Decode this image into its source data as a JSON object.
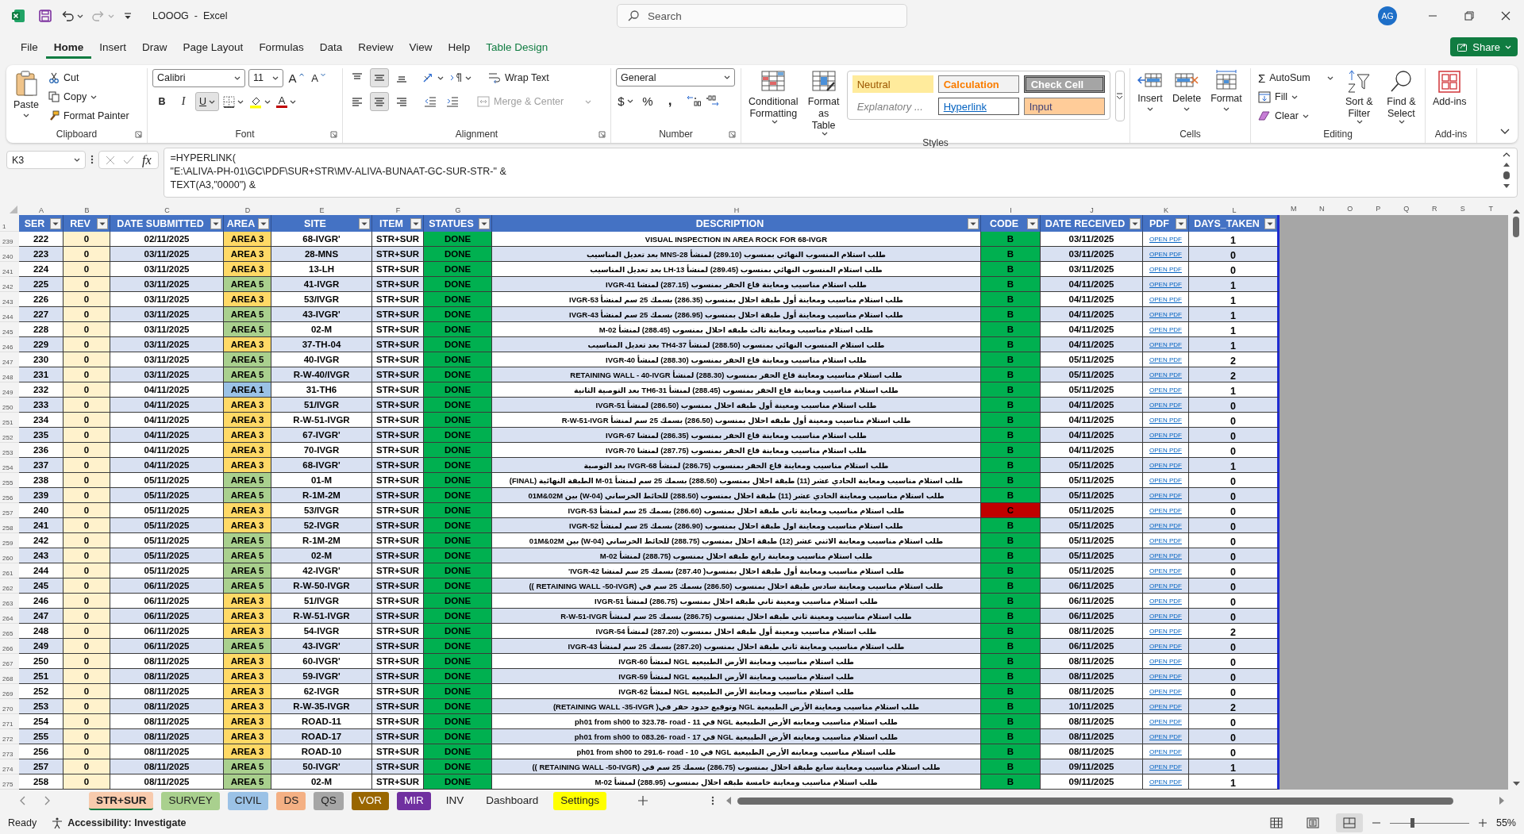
{
  "title_bar": {
    "title": "LOOOG  -  Excel",
    "search_placeholder": "Search",
    "user_initials": "AG"
  },
  "menu_tabs": [
    {
      "label": "File",
      "selected": false
    },
    {
      "label": "Home",
      "selected": true
    },
    {
      "label": "Insert",
      "selected": false
    },
    {
      "label": "Draw",
      "selected": false
    },
    {
      "label": "Page Layout",
      "selected": false
    },
    {
      "label": "Formulas",
      "selected": false
    },
    {
      "label": "Data",
      "selected": false
    },
    {
      "label": "Review",
      "selected": false
    },
    {
      "label": "View",
      "selected": false
    },
    {
      "label": "Help",
      "selected": false
    },
    {
      "label": "Table Design",
      "selected": false,
      "kind": "contextual"
    }
  ],
  "share_button": "Share",
  "ribbon": {
    "clipboard": {
      "label": "Clipboard",
      "paste": "Paste",
      "cut": "Cut",
      "copy": "Copy",
      "format_painter": "Format Painter"
    },
    "font": {
      "label": "Font",
      "font_name": "Calibri",
      "font_size": "11",
      "grow_font": "A",
      "shrink_font": "A",
      "bold": "B",
      "italic": "I",
      "underline": {
        "text": "U",
        "on": true
      },
      "font_color": "A"
    },
    "alignment": {
      "label": "Alignment",
      "vertical_buttons": [
        {
          "kind": "top",
          "selected": false
        },
        {
          "kind": "middle",
          "selected": true
        },
        {
          "kind": "bottom",
          "selected": false
        }
      ],
      "horizontal_buttons": [
        {
          "kind": "left",
          "selected": false
        },
        {
          "kind": "center",
          "selected": true
        },
        {
          "kind": "right",
          "selected": false
        }
      ],
      "wrap_text": "Wrap Text",
      "merge_center": {
        "text": "Merge & Center",
        "disabled": true
      }
    },
    "number": {
      "label": "Number",
      "format": "General",
      "currency": "$",
      "percent": "%",
      "comma": ","
    },
    "styles": {
      "label": "Styles",
      "conditional_formatting": "Conditional Formatting",
      "format_as_table": "Format as Table",
      "cell_styles": [
        {
          "text": "Neutral",
          "kind": "neutral"
        },
        {
          "text": "Calculation",
          "kind": "calculation"
        },
        {
          "text": "Check Cell",
          "kind": "check"
        },
        {
          "text": "Explanatory ...",
          "kind": "explanatory"
        },
        {
          "text": "Hyperlink",
          "kind": "hyperlink"
        },
        {
          "text": "Input",
          "kind": "input"
        }
      ]
    },
    "cells": {
      "label": "Cells",
      "buttons": [
        {
          "text": "Insert",
          "kind": "insert"
        },
        {
          "text": "Delete",
          "kind": "delete"
        },
        {
          "text": "Format",
          "kind": "format"
        }
      ]
    },
    "editing": {
      "label": "Editing",
      "autosum_icon": "Σ",
      "autosum": "AutoSum",
      "fill": "Fill",
      "clear": "Clear",
      "sort_filter": "Sort & Filter",
      "find_select": "Find & Select"
    },
    "addins": {
      "label": "Add-ins",
      "button": "Add-ins"
    }
  },
  "formula_bar": {
    "name_box": "K3",
    "fx": "fx",
    "formula": "=HYPERLINK(\n\"E:\\ALIVA-PH-01\\GC\\PDF\\SUR+STR\\MV-ALIVA-BUNAAT-GC-SUR-STR-\" &\nTEXT(A3,\"0000\") &"
  },
  "sheet": {
    "column_letters": [
      "A",
      "B",
      "C",
      "D",
      "E",
      "F",
      "G",
      "H",
      "I",
      "J",
      "K",
      "L",
      "M",
      "N",
      "O",
      "P",
      "Q",
      "R",
      "S",
      "T"
    ],
    "header_row_number": "1",
    "columns": [
      "SER",
      "REV",
      "DATE SUBMITTED",
      "AREA",
      "SITE",
      "ITEM",
      "STATUES",
      "DESCRIPTION",
      "CODE",
      "DATE RECEIVED",
      "PDF",
      "DAYS_TAKEN"
    ],
    "rows": [
      {
        "row_number": "239",
        "ser": "222",
        "rev": "0",
        "date_submitted": "02/11/2025",
        "area": {
          "text": "AREA 3",
          "color": "#ffd966"
        },
        "site": "68-IVGR'",
        "item": "STR+SUR",
        "status": "DONE",
        "description": "VISUAL INSPECTION IN AREA ROCK FOR 68-IVGR",
        "code": {
          "text": "B",
          "color": "#00b050"
        },
        "date_received": "03/11/2025",
        "pdf": "OPEN PDF",
        "days_taken": "1"
      },
      {
        "row_number": "240",
        "ser": "223",
        "rev": "0",
        "date_submitted": "03/11/2025",
        "area": {
          "text": "AREA 3",
          "color": "#ffd966"
        },
        "site": "28-MNS",
        "item": "STR+SUR",
        "status": "DONE",
        "description": "طلب استلام المنسوب النهائي بمنسوب (289.10) لمنشأ MNS-28 بعد تعديل المناسيب",
        "code": {
          "text": "B",
          "color": "#00b050"
        },
        "date_received": "03/11/2025",
        "pdf": "OPEN PDF",
        "days_taken": "0"
      },
      {
        "row_number": "241",
        "ser": "224",
        "rev": "0",
        "date_submitted": "03/11/2025",
        "area": {
          "text": "AREA 3",
          "color": "#ffd966"
        },
        "site": "13-LH",
        "item": "STR+SUR",
        "status": "DONE",
        "description": "طلب استلام المنسوب النهائي بمنسوب (289.45) لمنشأ LH-13 بعد تعديل المناسيب",
        "code": {
          "text": "B",
          "color": "#00b050"
        },
        "date_received": "03/11/2025",
        "pdf": "OPEN PDF",
        "days_taken": "0"
      },
      {
        "row_number": "242",
        "ser": "225",
        "rev": "0",
        "date_submitted": "03/11/2025",
        "area": {
          "text": "AREA 5",
          "color": "#a9d08e"
        },
        "site": "41-IVGR",
        "item": "STR+SUR",
        "status": "DONE",
        "description": "طلب استلام مناسيب ومعاينة قاع الحفر بمنسوب (287.15) لمنشا IVGR-41",
        "code": {
          "text": "B",
          "color": "#00b050"
        },
        "date_received": "04/11/2025",
        "pdf": "OPEN PDF",
        "days_taken": "1"
      },
      {
        "row_number": "243",
        "ser": "226",
        "rev": "0",
        "date_submitted": "03/11/2025",
        "area": {
          "text": "AREA 3",
          "color": "#ffd966"
        },
        "site": "53/IVGR",
        "item": "STR+SUR",
        "status": "DONE",
        "description": "طلب استلام مناسيب ومعاينة أول طبقة احلال بمنسوب (286.35) بسمك 25 سم لمنشأ IVGR-53",
        "code": {
          "text": "B",
          "color": "#00b050"
        },
        "date_received": "04/11/2025",
        "pdf": "OPEN PDF",
        "days_taken": "1"
      },
      {
        "row_number": "244",
        "ser": "227",
        "rev": "0",
        "date_submitted": "03/11/2025",
        "area": {
          "text": "AREA 5",
          "color": "#a9d08e"
        },
        "site": "43-IVGR'",
        "item": "STR+SUR",
        "status": "DONE",
        "description": "طلب استلام مناسيب ومعاينة أول طبقة احلال بمنسوب (286.95) بسمك 25 سم لمنشأ IVGR-43",
        "code": {
          "text": "B",
          "color": "#00b050"
        },
        "date_received": "04/11/2025",
        "pdf": "OPEN PDF",
        "days_taken": "1"
      },
      {
        "row_number": "245",
        "ser": "228",
        "rev": "0",
        "date_submitted": "03/11/2025",
        "area": {
          "text": "AREA 5",
          "color": "#a9d08e"
        },
        "site": "02-M",
        "item": "STR+SUR",
        "status": "DONE",
        "description": "طلب استلام مناسيب ومعاينة ثالث طبقه احلال بمنسوب (288.45) لمنشأ M-02",
        "code": {
          "text": "B",
          "color": "#00b050"
        },
        "date_received": "04/11/2025",
        "pdf": "OPEN PDF",
        "days_taken": "1"
      },
      {
        "row_number": "246",
        "ser": "229",
        "rev": "0",
        "date_submitted": "03/11/2025",
        "area": {
          "text": "AREA 3",
          "color": "#ffd966"
        },
        "site": "37-TH-04",
        "item": "STR+SUR",
        "status": "DONE",
        "description": "طلب استلام المنسوب النهائي بمنسوب (288.50) لمنشأ TH4-37 بعد تعديل المناسيب",
        "code": {
          "text": "B",
          "color": "#00b050"
        },
        "date_received": "04/11/2025",
        "pdf": "OPEN PDF",
        "days_taken": "1"
      },
      {
        "row_number": "247",
        "ser": "230",
        "rev": "0",
        "date_submitted": "03/11/2025",
        "area": {
          "text": "AREA 5",
          "color": "#a9d08e"
        },
        "site": "40-IVGR",
        "item": "STR+SUR",
        "status": "DONE",
        "description": "طلب استلام مناسيب ومعاينة قاع الحفر بمنسوب (288.30) لمنشأ IVGR-40",
        "code": {
          "text": "B",
          "color": "#00b050"
        },
        "date_received": "05/11/2025",
        "pdf": "OPEN PDF",
        "days_taken": "2"
      },
      {
        "row_number": "248",
        "ser": "231",
        "rev": "0",
        "date_submitted": "03/11/2025",
        "area": {
          "text": "AREA 5",
          "color": "#a9d08e"
        },
        "site": "R-W-40/IVGR",
        "item": "STR+SUR",
        "status": "DONE",
        "description": "طلب استلام مناسيب ومعاينة قاع الحفر بمنسوب (288.30) لمنشأ RETAINING WALL - 40-IVGR",
        "code": {
          "text": "B",
          "color": "#00b050"
        },
        "date_received": "05/11/2025",
        "pdf": "OPEN PDF",
        "days_taken": "2"
      },
      {
        "row_number": "249",
        "ser": "232",
        "rev": "0",
        "date_submitted": "04/11/2025",
        "area": {
          "text": "AREA 1",
          "color": "#9bc2e6"
        },
        "site": "31-TH6",
        "item": "STR+SUR",
        "status": "DONE",
        "description": "طلب استلام مناسيب ومعاينة قاع الحفر بمنسوب (288.45) لمنشأ TH6-31 بعد التوصية الثانية",
        "code": {
          "text": "B",
          "color": "#00b050"
        },
        "date_received": "05/11/2025",
        "pdf": "OPEN PDF",
        "days_taken": "1"
      },
      {
        "row_number": "250",
        "ser": "233",
        "rev": "0",
        "date_submitted": "04/11/2025",
        "area": {
          "text": "AREA 3",
          "color": "#ffd966"
        },
        "site": "51/IVGR",
        "item": "STR+SUR",
        "status": "DONE",
        "description": "طلب استلام مناسيب ومعينة أول طبقه احلال بمنسوب (286.50) لمنشأ IVGR-51",
        "code": {
          "text": "B",
          "color": "#00b050"
        },
        "date_received": "04/11/2025",
        "pdf": "OPEN PDF",
        "days_taken": "0"
      },
      {
        "row_number": "251",
        "ser": "234",
        "rev": "0",
        "date_submitted": "04/11/2025",
        "area": {
          "text": "AREA 3",
          "color": "#ffd966"
        },
        "site": "R-W-51-IVGR",
        "item": "STR+SUR",
        "status": "DONE",
        "description": "طلب استلام مناسيب ومعينة أول طبقه احلال بمنسوب (286.50) بسمك 25 سم لمنشأ R-W-51-IVGR",
        "code": {
          "text": "B",
          "color": "#00b050"
        },
        "date_received": "04/11/2025",
        "pdf": "OPEN PDF",
        "days_taken": "0"
      },
      {
        "row_number": "252",
        "ser": "235",
        "rev": "0",
        "date_submitted": "04/11/2025",
        "area": {
          "text": "AREA 3",
          "color": "#ffd966"
        },
        "site": "67-IVGR'",
        "item": "STR+SUR",
        "status": "DONE",
        "description": "طلب استلام مناسيب ومعاينة قاع الحفر بمنسوب (286.35) لمنشا IVGR-67",
        "code": {
          "text": "B",
          "color": "#00b050"
        },
        "date_received": "04/11/2025",
        "pdf": "OPEN PDF",
        "days_taken": "0"
      },
      {
        "row_number": "253",
        "ser": "236",
        "rev": "0",
        "date_submitted": "04/11/2025",
        "area": {
          "text": "AREA 3",
          "color": "#ffd966"
        },
        "site": "70-IVGR",
        "item": "STR+SUR",
        "status": "DONE",
        "description": "طلب استلام مناسيب ومعاينة قاع الحفر بمنسوب (287.75) لمنشا IVGR-70",
        "code": {
          "text": "B",
          "color": "#00b050"
        },
        "date_received": "04/11/2025",
        "pdf": "OPEN PDF",
        "days_taken": "0"
      },
      {
        "row_number": "254",
        "ser": "237",
        "rev": "0",
        "date_submitted": "04/11/2025",
        "area": {
          "text": "AREA 3",
          "color": "#ffd966"
        },
        "site": "68-IVGR'",
        "item": "STR+SUR",
        "status": "DONE",
        "description": "طلب استلام مناسيب ومعاينة قاع الحفر بمنسوب (286.75) لمنشأ IVGR-68 بعد التوصية",
        "code": {
          "text": "B",
          "color": "#00b050"
        },
        "date_received": "05/11/2025",
        "pdf": "OPEN PDF",
        "days_taken": "1"
      },
      {
        "row_number": "255",
        "ser": "238",
        "rev": "0",
        "date_submitted": "05/11/2025",
        "area": {
          "text": "AREA 5",
          "color": "#a9d08e"
        },
        "site": "01-M",
        "item": "STR+SUR",
        "status": "DONE",
        "description": "طلب استلام مناسيب ومعاينة الحادي عشر (11) طبقة احلال بمنسوب (288.50) بسمك 25 سم لمنشأ M-01 الطبقة النهائية (FINAL)",
        "code": {
          "text": "B",
          "color": "#00b050"
        },
        "date_received": "05/11/2025",
        "pdf": "OPEN PDF",
        "days_taken": "0"
      },
      {
        "row_number": "256",
        "ser": "239",
        "rev": "0",
        "date_submitted": "05/11/2025",
        "area": {
          "text": "AREA 5",
          "color": "#a9d08e"
        },
        "site": "R-1M-2M",
        "item": "STR+SUR",
        "status": "DONE",
        "description": "طلب استلام مناسيب ومعاينة الحادي عشر (11) طبقة احلال بمنسوب (288.50) للحائط الخرساني (W-04) بين 01M&02M",
        "code": {
          "text": "B",
          "color": "#00b050"
        },
        "date_received": "05/11/2025",
        "pdf": "OPEN PDF",
        "days_taken": "0"
      },
      {
        "row_number": "257",
        "ser": "240",
        "rev": "0",
        "date_submitted": "05/11/2025",
        "area": {
          "text": "AREA 3",
          "color": "#ffd966"
        },
        "site": "53/IVGR",
        "item": "STR+SUR",
        "status": "DONE",
        "description": "طلب استلام مناسيب ومعاينة ثاني طبقة احلال بمنسوب (286.60) بسمك 25 سم لمنشأ IVGR-53",
        "code": {
          "text": "C",
          "color": "#c00000"
        },
        "date_received": "05/11/2025",
        "pdf": "OPEN PDF",
        "days_taken": "0"
      },
      {
        "row_number": "258",
        "ser": "241",
        "rev": "0",
        "date_submitted": "05/11/2025",
        "area": {
          "text": "AREA 3",
          "color": "#ffd966"
        },
        "site": "52-IVGR",
        "item": "STR+SUR",
        "status": "DONE",
        "description": "طلب استلام مناسيب ومعاينة اول طبقة احلال بمنسوب (286.90) بسمك 25 سم لمنشأ IVGR-52",
        "code": {
          "text": "B",
          "color": "#00b050"
        },
        "date_received": "05/11/2025",
        "pdf": "OPEN PDF",
        "days_taken": "0"
      },
      {
        "row_number": "259",
        "ser": "242",
        "rev": "0",
        "date_submitted": "05/11/2025",
        "area": {
          "text": "AREA 5",
          "color": "#a9d08e"
        },
        "site": "R-1M-2M",
        "item": "STR+SUR",
        "status": "DONE",
        "description": "طلب استلام مناسيب ومعاينة الاثني عشر (12) طبقة احلال بمنسوب (288.75) للحائط الخرساني (W-04) بين 01M&02M",
        "code": {
          "text": "B",
          "color": "#00b050"
        },
        "date_received": "05/11/2025",
        "pdf": "OPEN PDF",
        "days_taken": "0"
      },
      {
        "row_number": "260",
        "ser": "243",
        "rev": "0",
        "date_submitted": "05/11/2025",
        "area": {
          "text": "AREA 5",
          "color": "#a9d08e"
        },
        "site": "02-M",
        "item": "STR+SUR",
        "status": "DONE",
        "description": "طلب استلام مناسيب ومعاينة رابع طبقه احلال بمنسوب (288.75) لمنشأ M-02",
        "code": {
          "text": "B",
          "color": "#00b050"
        },
        "date_received": "05/11/2025",
        "pdf": "OPEN PDF",
        "days_taken": "0"
      },
      {
        "row_number": "261",
        "ser": "244",
        "rev": "0",
        "date_submitted": "05/11/2025",
        "area": {
          "text": "AREA 5",
          "color": "#a9d08e"
        },
        "site": "42-IVGR'",
        "item": "STR+SUR",
        "status": "DONE",
        "description": "طلب استلام مناسيب ومعاينة أول طبقة احلال بمنسوب( 287.40) بسمك 25 سم لمنشا IVGR-42'",
        "code": {
          "text": "B",
          "color": "#00b050"
        },
        "date_received": "05/11/2025",
        "pdf": "OPEN PDF",
        "days_taken": "0"
      },
      {
        "row_number": "262",
        "ser": "245",
        "rev": "0",
        "date_submitted": "06/11/2025",
        "area": {
          "text": "AREA 5",
          "color": "#a9d08e"
        },
        "site": "R-W-50-IVGR",
        "item": "STR+SUR",
        "status": "DONE",
        "description": "طلب استلام مناسيب ومعاينة سادس طبقة احلال بمنسوب (286.50) بسمك 25 سم في (RETAINING WALL -50-IVGR ))",
        "code": {
          "text": "B",
          "color": "#00b050"
        },
        "date_received": "06/11/2025",
        "pdf": "OPEN PDF",
        "days_taken": "0"
      },
      {
        "row_number": "263",
        "ser": "246",
        "rev": "0",
        "date_submitted": "06/11/2025",
        "area": {
          "text": "AREA 3",
          "color": "#ffd966"
        },
        "site": "51/IVGR",
        "item": "STR+SUR",
        "status": "DONE",
        "description": "طلب استلام مناسيب ومعينة ثاني طبقه احلال بمنسوب (286.75) لمنشأ IVGR-51",
        "code": {
          "text": "B",
          "color": "#00b050"
        },
        "date_received": "06/11/2025",
        "pdf": "OPEN PDF",
        "days_taken": "0"
      },
      {
        "row_number": "264",
        "ser": "247",
        "rev": "0",
        "date_submitted": "06/11/2025",
        "area": {
          "text": "AREA 3",
          "color": "#ffd966"
        },
        "site": "R-W-51-IVGR",
        "item": "STR+SUR",
        "status": "DONE",
        "description": "طلب استلام مناسيب ومعينة ثاني طبقه احلال بمنسوب (286.75) بسمك 25 سم لمنشأ R-W-51-IVGR",
        "code": {
          "text": "B",
          "color": "#00b050"
        },
        "date_received": "06/11/2025",
        "pdf": "OPEN PDF",
        "days_taken": "0"
      },
      {
        "row_number": "265",
        "ser": "248",
        "rev": "0",
        "date_submitted": "06/11/2025",
        "area": {
          "text": "AREA 3",
          "color": "#ffd966"
        },
        "site": "54-IVGR",
        "item": "STR+SUR",
        "status": "DONE",
        "description": "طلب استلام مناسيب ومعينة أول طبقه احلال بمنسوب (287.20) لمنشأ IVGR-54",
        "code": {
          "text": "B",
          "color": "#00b050"
        },
        "date_received": "08/11/2025",
        "pdf": "OPEN PDF",
        "days_taken": "2"
      },
      {
        "row_number": "266",
        "ser": "249",
        "rev": "0",
        "date_submitted": "06/11/2025",
        "area": {
          "text": "AREA 5",
          "color": "#a9d08e"
        },
        "site": "43-IVGR'",
        "item": "STR+SUR",
        "status": "DONE",
        "description": "طلب استلام مناسيب ومعاينة ثاني طبقة احلال بمنسوب (287.20) بسمك 25 سم لمنشأ IVGR-43",
        "code": {
          "text": "B",
          "color": "#00b050"
        },
        "date_received": "06/11/2025",
        "pdf": "OPEN PDF",
        "days_taken": "0"
      },
      {
        "row_number": "267",
        "ser": "250",
        "rev": "0",
        "date_submitted": "08/11/2025",
        "area": {
          "text": "AREA 3",
          "color": "#ffd966"
        },
        "site": "60-IVGR'",
        "item": "STR+SUR",
        "status": "DONE",
        "description": "طلب استلام مناسيب ومعاينة الأرض الطبيعيه NGL لمنشأ IVGR-60",
        "code": {
          "text": "B",
          "color": "#00b050"
        },
        "date_received": "08/11/2025",
        "pdf": "OPEN PDF",
        "days_taken": "0"
      },
      {
        "row_number": "268",
        "ser": "251",
        "rev": "0",
        "date_submitted": "08/11/2025",
        "area": {
          "text": "AREA 3",
          "color": "#ffd966"
        },
        "site": "59-IVGR'",
        "item": "STR+SUR",
        "status": "DONE",
        "description": "طلب استلام مناسيب ومعاينة الأرض الطبيعيه NGL لمنشأ IVGR-59",
        "code": {
          "text": "B",
          "color": "#00b050"
        },
        "date_received": "08/11/2025",
        "pdf": "OPEN PDF",
        "days_taken": "0"
      },
      {
        "row_number": "269",
        "ser": "252",
        "rev": "0",
        "date_submitted": "08/11/2025",
        "area": {
          "text": "AREA 3",
          "color": "#ffd966"
        },
        "site": "62-IVGR",
        "item": "STR+SUR",
        "status": "DONE",
        "description": "طلب استلام مناسيب ومعاينة الأرض الطبيعيه NGL لمنشأ IVGR-62",
        "code": {
          "text": "B",
          "color": "#00b050"
        },
        "date_received": "08/11/2025",
        "pdf": "OPEN PDF",
        "days_taken": "0"
      },
      {
        "row_number": "270",
        "ser": "253",
        "rev": "0",
        "date_submitted": "08/11/2025",
        "area": {
          "text": "AREA 3",
          "color": "#ffd966"
        },
        "site": "R-W-35-IVGR",
        "item": "STR+SUR",
        "status": "DONE",
        "description": "طلب استلام مناسيب ومعاينة الأرض الطبيعية NGL وتوقيع حدود حفر في( RETAINING WALL -35-IVGR)",
        "code": {
          "text": "B",
          "color": "#00b050"
        },
        "date_received": "10/11/2025",
        "pdf": "OPEN PDF",
        "days_taken": "2"
      },
      {
        "row_number": "271",
        "ser": "254",
        "rev": "0",
        "date_submitted": "08/11/2025",
        "area": {
          "text": "AREA 3",
          "color": "#ffd966"
        },
        "site": "ROAD-11",
        "item": "STR+SUR",
        "status": "DONE",
        "description": "طلب استلام مناسيب ومعاينه الأرض الطبيعية NGL في ph01 from sh00 to 323.78- road - 11",
        "code": {
          "text": "B",
          "color": "#00b050"
        },
        "date_received": "08/11/2025",
        "pdf": "OPEN PDF",
        "days_taken": "0"
      },
      {
        "row_number": "272",
        "ser": "255",
        "rev": "0",
        "date_submitted": "08/11/2025",
        "area": {
          "text": "AREA 3",
          "color": "#ffd966"
        },
        "site": "ROAD-17",
        "item": "STR+SUR",
        "status": "DONE",
        "description": "طلب استلام مناسيب ومعاينه الأرض الطبيعية NGL في ph01 from sh00 to 083.26- road - 17",
        "code": {
          "text": "B",
          "color": "#00b050"
        },
        "date_received": "08/11/2025",
        "pdf": "OPEN PDF",
        "days_taken": "0"
      },
      {
        "row_number": "273",
        "ser": "256",
        "rev": "0",
        "date_submitted": "08/11/2025",
        "area": {
          "text": "AREA 3",
          "color": "#ffd966"
        },
        "site": "ROAD-10",
        "item": "STR+SUR",
        "status": "DONE",
        "description": "طلب استلام مناسيب ومعاينه الأرض الطبيعية NGL في ph01 from sh00 to 291.6- road - 10",
        "code": {
          "text": "B",
          "color": "#00b050"
        },
        "date_received": "08/11/2025",
        "pdf": "OPEN PDF",
        "days_taken": "0"
      },
      {
        "row_number": "274",
        "ser": "257",
        "rev": "0",
        "date_submitted": "08/11/2025",
        "area": {
          "text": "AREA 5",
          "color": "#a9d08e"
        },
        "site": "50-IVGR'",
        "item": "STR+SUR",
        "status": "DONE",
        "description": "طلب استلام مناسيب ومعاينة سابع طبقة احلال بمنسوب (286.75) بسمك 25 سم في (RETAINING WALL -50-IVGR ))",
        "code": {
          "text": "B",
          "color": "#00b050"
        },
        "date_received": "09/11/2025",
        "pdf": "OPEN PDF",
        "days_taken": "1"
      },
      {
        "row_number": "275",
        "ser": "258",
        "rev": "0",
        "date_submitted": "08/11/2025",
        "area": {
          "text": "AREA 5",
          "color": "#a9d08e"
        },
        "site": "02-M",
        "item": "STR+SUR",
        "status": "DONE",
        "description": "طلب استلام مناسيب ومعاينة خامسة طبقه احلال بمنسوب (288.95) لمنشأ M-02",
        "code": {
          "text": "B",
          "color": "#00b050"
        },
        "date_received": "09/11/2025",
        "pdf": "OPEN PDF",
        "days_taken": "1"
      }
    ]
  },
  "sheet_tabs": [
    {
      "label": "STR+SUR",
      "color": "#f8cbad",
      "selected": true
    },
    {
      "label": "SURVEY",
      "color": "#a9d08e",
      "selected": false
    },
    {
      "label": "CIVIL",
      "color": "#9bc2e6",
      "selected": false
    },
    {
      "label": "DS",
      "color": "#f4b084",
      "selected": false
    },
    {
      "label": "QS",
      "color": "#a6a6a6",
      "selected": false
    },
    {
      "label": "VOR",
      "color": "#996600",
      "selected": false
    },
    {
      "label": "MIR",
      "color": "#7030a0",
      "selected": false
    },
    {
      "label": "INV",
      "selected": false
    },
    {
      "label": "Dashboard",
      "selected": false
    },
    {
      "label": "Settings",
      "color": "#ffff00",
      "selected": false
    }
  ],
  "status_bar": {
    "status": "Ready",
    "accessibility": "Accessibility: Investigate",
    "views": [
      {
        "kind": "normal",
        "selected": false
      },
      {
        "kind": "page_layout",
        "selected": false
      },
      {
        "kind": "page_break",
        "selected": true
      }
    ],
    "zoom_slider": {
      "level": 0.28
    },
    "zoom": "55%"
  }
}
